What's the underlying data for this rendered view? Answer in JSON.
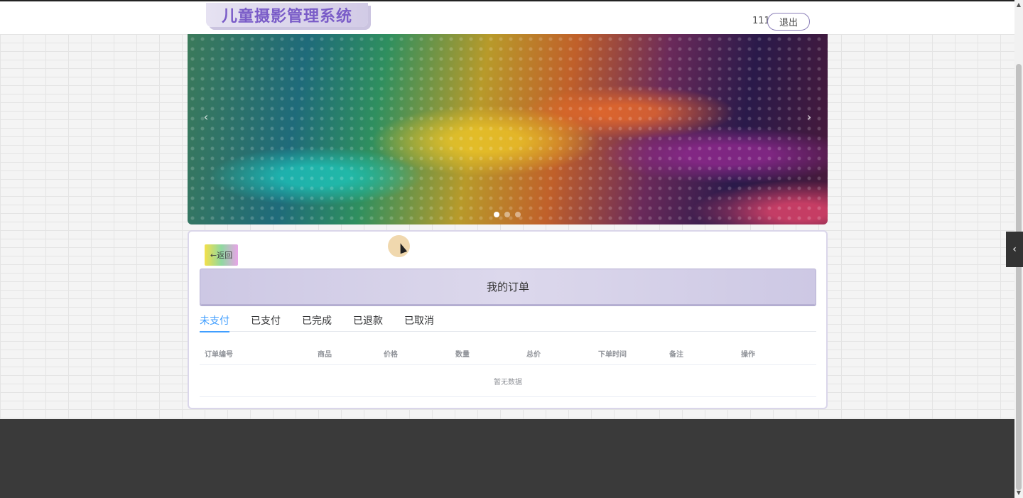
{
  "header": {
    "logo_text": "儿童摄影管理系统",
    "username": "111",
    "logout_label": "退出"
  },
  "carousel": {
    "prev_icon": "‹",
    "next_icon": "›",
    "slide_count": 3,
    "active_index": 0
  },
  "page": {
    "back_label": "←返回",
    "title": "我的订单"
  },
  "tabs": [
    {
      "label": "未支付",
      "active": true
    },
    {
      "label": "已支付",
      "active": false
    },
    {
      "label": "已完成",
      "active": false
    },
    {
      "label": "已退款",
      "active": false
    },
    {
      "label": "已取消",
      "active": false
    }
  ],
  "table": {
    "columns": [
      "订单编号",
      "商品",
      "价格",
      "数量",
      "总价",
      "下单时间",
      "备注",
      "操作"
    ],
    "rows": [],
    "empty_text": "暂无数据"
  },
  "side_toggle_icon": "‹",
  "colors": {
    "accent": "#409eff",
    "logo_text": "#7a5cc8",
    "footer": "#3a3a3a"
  }
}
